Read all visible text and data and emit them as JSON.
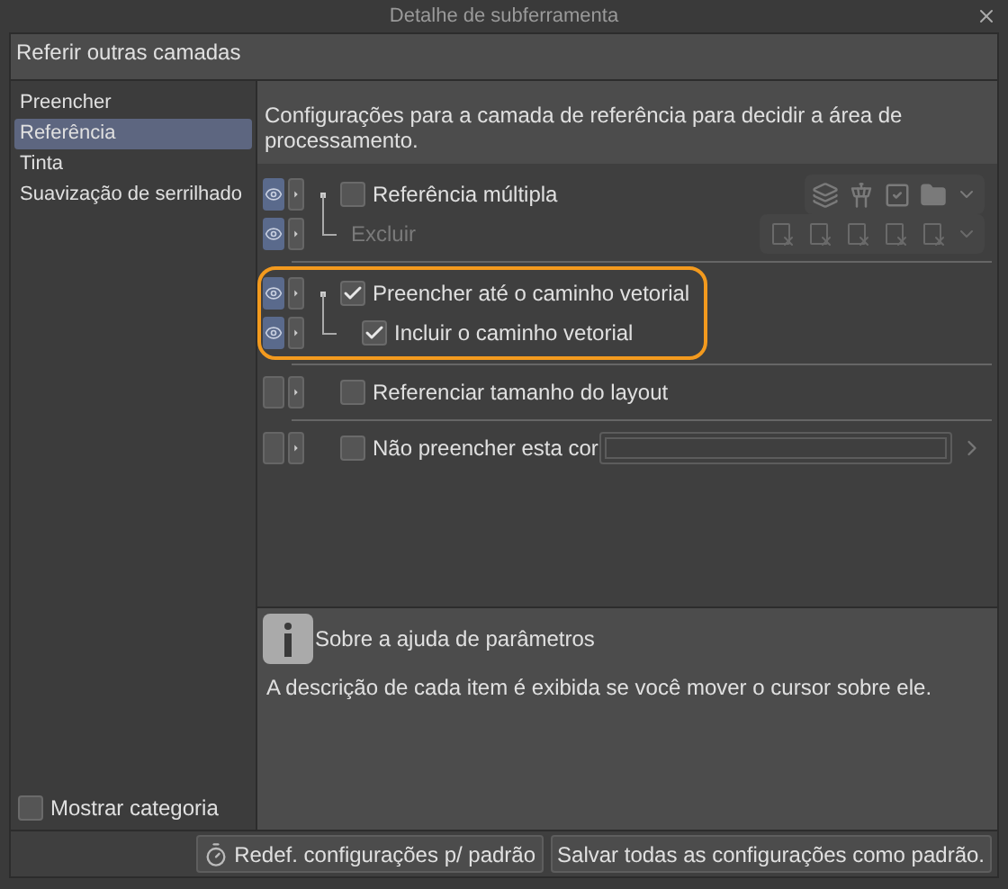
{
  "window": {
    "title": "Detalhe de subferramenta"
  },
  "tool_name": {
    "value": "Referir outras camadas"
  },
  "sidebar": {
    "items": [
      {
        "label": "Preencher",
        "selected": false
      },
      {
        "label": "Referência",
        "selected": true
      },
      {
        "label": "Tinta",
        "selected": false
      },
      {
        "label": "Suavização de serrilhado",
        "selected": false
      }
    ],
    "show_category": {
      "label": "Mostrar categoria",
      "checked": false
    }
  },
  "description": "Configurações para a camada de referência para decidir a área de processamento.",
  "groups": [
    {
      "highlighted": false,
      "rows": [
        {
          "kind": "checkbox",
          "label": "Referência múltipla",
          "eye": true,
          "checked": false,
          "disabled": false,
          "toolbar": {
            "kind": "layers"
          },
          "children": [
            {
              "kind": "plain",
              "label": "Excluir",
              "eye": true,
              "disabled": true,
              "toolbar": {
                "kind": "exclude"
              }
            }
          ]
        }
      ]
    },
    {
      "highlighted": true,
      "rows": [
        {
          "kind": "checkbox",
          "label": "Preencher até o caminho vetorial",
          "eye": true,
          "checked": true,
          "disabled": false,
          "children": [
            {
              "kind": "checkbox",
              "label": "Incluir o caminho vetorial",
              "eye": true,
              "checked": true,
              "disabled": false
            }
          ]
        }
      ]
    },
    {
      "highlighted": false,
      "rows": [
        {
          "kind": "checkbox",
          "label": "Referenciar tamanho do layout",
          "eye": false,
          "checked": false,
          "disabled": false
        }
      ]
    },
    {
      "highlighted": false,
      "rows": [
        {
          "kind": "color",
          "label": "Não preencher esta cor",
          "eye": false,
          "checked": false,
          "disabled": false
        }
      ]
    }
  ],
  "help": {
    "title": "Sobre a ajuda de parâmetros",
    "text": "A descrição de cada item é exibida se você mover o cursor sobre ele."
  },
  "buttons": [
    {
      "kind": "reset",
      "label": "Redef. configurações p/ padrão"
    },
    {
      "kind": "save",
      "label": "Salvar todas as configurações como padrão."
    }
  ]
}
